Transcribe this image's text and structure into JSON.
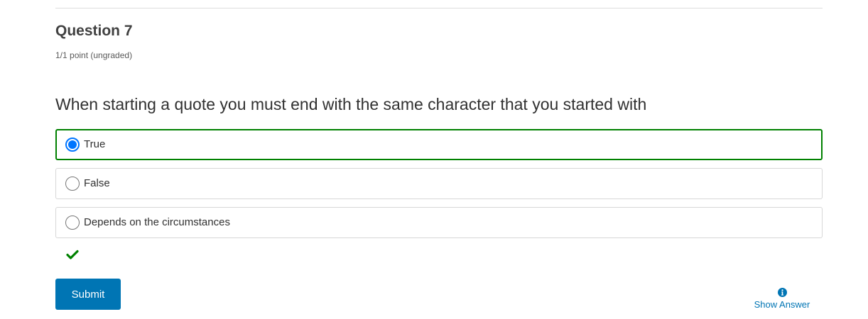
{
  "question": {
    "title": "Question 7",
    "points": "1/1 point (ungraded)",
    "prompt": "When starting a quote you must end with the same character that you started with"
  },
  "options": [
    {
      "label": "True",
      "selected": true,
      "correct": true
    },
    {
      "label": "False",
      "selected": false,
      "correct": false
    },
    {
      "label": "Depends on the circumstances",
      "selected": false,
      "correct": false
    }
  ],
  "result": {
    "icon": "checkmark-icon",
    "status": "correct",
    "color": "#008100"
  },
  "actions": {
    "submit_label": "Submit",
    "show_answer_label": "Show Answer",
    "show_answer_icon": "info-icon"
  },
  "colors": {
    "accent": "#0075b4",
    "correct_border": "#008100",
    "radio_selected": "#0075ff"
  }
}
